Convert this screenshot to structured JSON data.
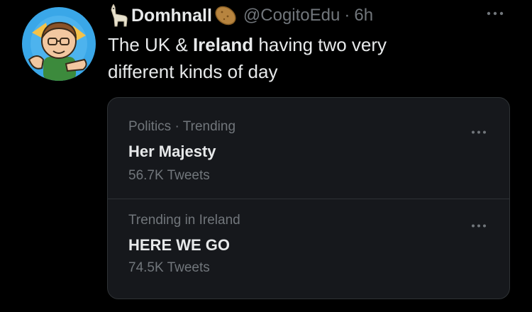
{
  "tweet": {
    "display_name": "Domhnall",
    "handle": "@CogitoEdu",
    "separator": "·",
    "time": "6h",
    "text_before": "The UK & ",
    "text_bold": "Ireland",
    "text_after": " having two very different kinds of day",
    "name_icons": [
      "llama-icon",
      "potato-icon"
    ]
  },
  "trends": [
    {
      "context": "Politics · Trending",
      "name": "Her Majesty",
      "count": "56.7K Tweets"
    },
    {
      "context": "Trending in Ireland",
      "name": "HERE WE GO",
      "count": "74.5K Tweets"
    }
  ],
  "colors": {
    "background": "#000000",
    "card": "#16181c",
    "primary_text": "#e7e9ea",
    "secondary_text": "#71767b",
    "border": "#2f3336"
  }
}
